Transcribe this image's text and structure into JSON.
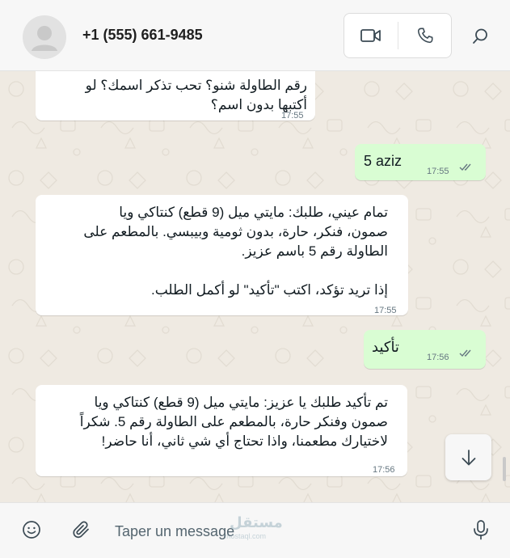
{
  "header": {
    "contact_name": "+1 (555) 661-9485",
    "icons": [
      "avatar-placeholder",
      "video-icon",
      "phone-icon",
      "search-icon"
    ]
  },
  "messages": [
    {
      "direction": "incoming",
      "text": "رقم الطاولة شنو؟ تحب تذكر اسمك؟ لو\nأكتبها بدون اسم؟",
      "time": "17:55"
    },
    {
      "direction": "outgoing",
      "text": "5 aziz",
      "time": "17:55",
      "status": "read"
    },
    {
      "direction": "incoming",
      "text": "تمام عيني، طلبك: مايتي ميل (9 قطع) كنتاكي ويا\nصمون، فنكر، حارة، بدون ثومية وبيبسي. بالمطعم على\nالطاولة رقم 5 باسم عزيز.\n\nإذا تريد تؤكد، اكتب \"تأكيد\" لو أكمل الطلب.",
      "time": "17:55"
    },
    {
      "direction": "outgoing",
      "text": "تأكيد",
      "time": "17:56",
      "status": "read"
    },
    {
      "direction": "incoming",
      "text": "تم تأكيد طلبك يا عزيز: مايتي ميل (9 قطع) كنتاكي ويا\nصمون وفنكر حارة، بالمطعم على الطاولة رقم 5. شكراً\nلاختيارك مطعمنا، واذا تحتاج أي شي ثاني، أنا حاضر!",
      "time": "17:56"
    }
  ],
  "composer": {
    "placeholder": "Taper un message",
    "icons": [
      "emoji-icon",
      "paperclip-icon",
      "microphone-icon"
    ]
  },
  "watermark": {
    "arabic": "مستقل",
    "latin": "mostaql.com"
  },
  "colors": {
    "chat_background": "#efeae2",
    "incoming_bubble": "#ffffff",
    "outgoing_bubble": "#d9fdd3",
    "header_background": "#f7f7f7",
    "read_ticks": "#667781"
  }
}
